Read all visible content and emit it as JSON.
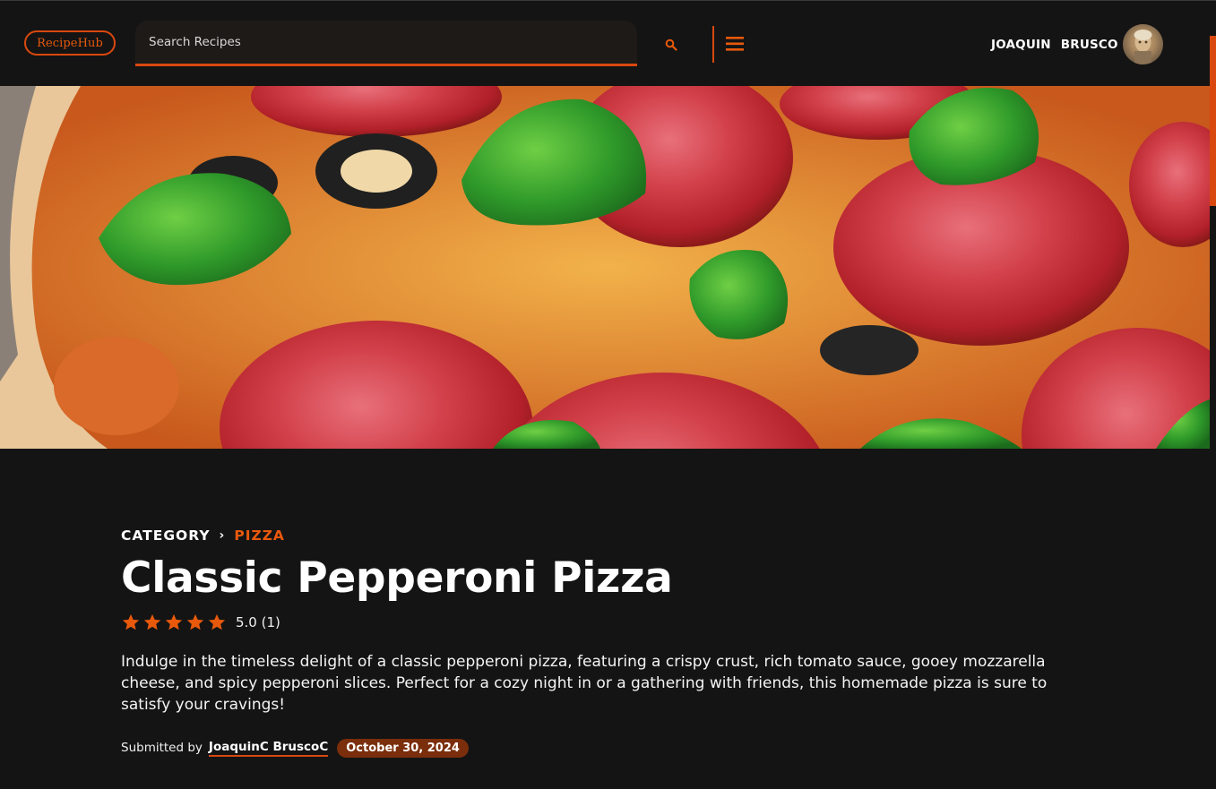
{
  "header": {
    "logo_text": "RecipeHub",
    "search_placeholder": "Search Recipes",
    "search_icon": "search-icon",
    "menu_icon": "hamburger-menu-icon",
    "user_first": "JOAQUIN",
    "user_last": "BRUSCO"
  },
  "recipe": {
    "breadcrumb_root": "CATEGORY",
    "breadcrumb_category": "PIZZA",
    "title": "Classic Pepperoni Pizza",
    "rating_stars": 5,
    "rating_text": "5.0 (1)",
    "description": "Indulge in the timeless delight of a classic pepperoni pizza, featuring a crispy crust, rich tomato sauce, gooey mozzarella cheese, and spicy pepperoni slices. Perfect for a cozy night in or a gathering with friends, this homemade pizza is sure to satisfy your cravings!",
    "submitted_label": "Submitted by",
    "author": "JoaquinC BruscoC",
    "date": "October 30, 2024"
  },
  "colors": {
    "accent": "#d9480f",
    "background": "#141414",
    "date_badge": "#7a2e0c"
  }
}
